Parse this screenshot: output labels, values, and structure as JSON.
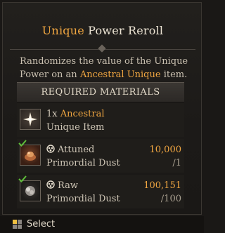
{
  "tooltip": {
    "title_accent": "Unique",
    "title_rest": " Power Reroll",
    "description_part1": "Randomizes the value of the Unique Power on an ",
    "description_accent": "Ancestral Unique",
    "description_part2": " item.",
    "materials_header": "REQUIRED MATERIALS",
    "materials": [
      {
        "qty_prefix": "1x ",
        "name_accent_line1": "Ancestral",
        "name_line2": "Unique Item",
        "icon": "star-glyph-icon",
        "fulfilled": false
      },
      {
        "name_line1": "Attuned",
        "name_line2": "Primordial Dust",
        "have": "10,000",
        "need": "/1",
        "icon": "attuned-dust-icon",
        "fulfilled": true
      },
      {
        "name_line1": "Raw",
        "name_line2": "Primordial Dust",
        "have": "100,151",
        "need": "/100",
        "icon": "raw-dust-icon",
        "fulfilled": true
      }
    ]
  },
  "footer": {
    "action_label": "Select",
    "key_icon": "mouse-button-icon"
  },
  "colors": {
    "accent": "#f0a641",
    "check": "#5fbf3a"
  }
}
